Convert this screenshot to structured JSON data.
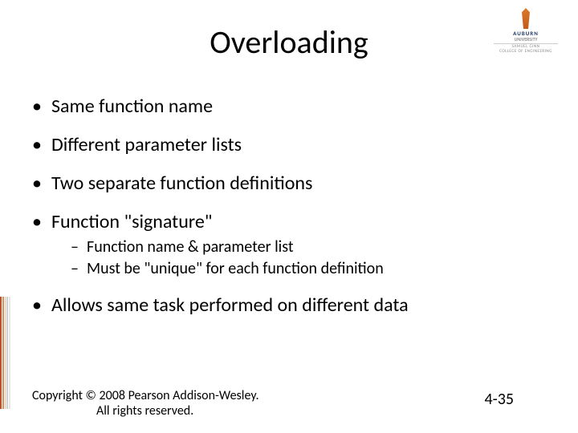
{
  "logo": {
    "university": "AUBURN",
    "sub1": "UNIVERSITY",
    "sub2": "SAMUEL GINN",
    "sub3": "COLLEGE OF ENGINEERING"
  },
  "title": "Overloading",
  "bullets": {
    "b1": "Same function name",
    "b2": "Different parameter lists",
    "b3": "Two separate function definitions",
    "b4": "Function \"signature\"",
    "b4_sub1": "Function name & parameter list",
    "b4_sub2": "Must be \"unique\" for each function definition",
    "b5": "Allows same task performed on different data"
  },
  "footer": {
    "copyright_line1": "Copyright © 2008 Pearson Addison-Wesley.",
    "copyright_line2": "All rights reserved.",
    "page": "4-35"
  }
}
